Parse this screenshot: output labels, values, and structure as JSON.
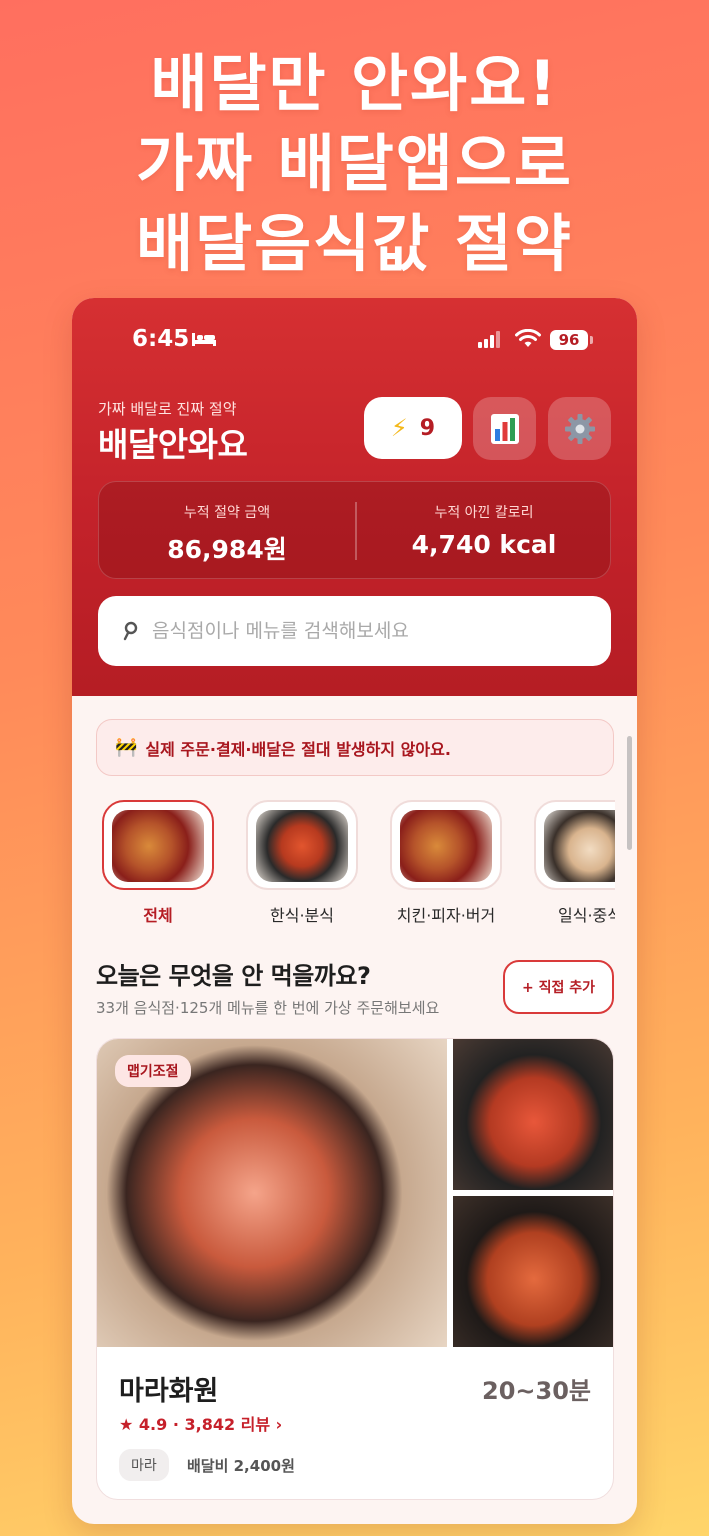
{
  "headline": [
    "배달만 안와요!",
    "가짜 배달앱으로",
    "배달음식값 절약"
  ],
  "status_bar": {
    "time": "6:45",
    "battery": "96"
  },
  "header": {
    "subtitle": "가짜 배달로 진짜 절약",
    "title": "배달안와요",
    "points": "9"
  },
  "summary": {
    "saved_label": "누적 절약 금액",
    "saved_value": "86,984원",
    "calories_label": "누적 아낀 칼로리",
    "calories_value": "4,740 kcal"
  },
  "search": {
    "placeholder": "음식점이나 메뉴를 검색해보세요"
  },
  "notice": {
    "text": "실제 주문·결제·배달은 절대 발생하지 않아요."
  },
  "categories": [
    {
      "label": "전체",
      "active": true
    },
    {
      "label": "한식·분식"
    },
    {
      "label": "치킨·피자·버거"
    },
    {
      "label": "일식·중식"
    }
  ],
  "section": {
    "title": "오늘은 무엇을 안 먹을까요?",
    "subtitle": "33개 음식점·125개 메뉴를 한 번에 가상 주문해보세요",
    "add_button": "+ 직접 추가"
  },
  "restaurant": {
    "badge": "맵기조절",
    "name": "마라화원",
    "eta": "20~30분",
    "rating_line": "★ 4.9  ·  3,842 리뷰 ›",
    "tag": "마라",
    "delivery_fee": "배달비 2,400원"
  },
  "colors": {
    "brand": "#c3222a",
    "accent": "#d93a3a"
  }
}
